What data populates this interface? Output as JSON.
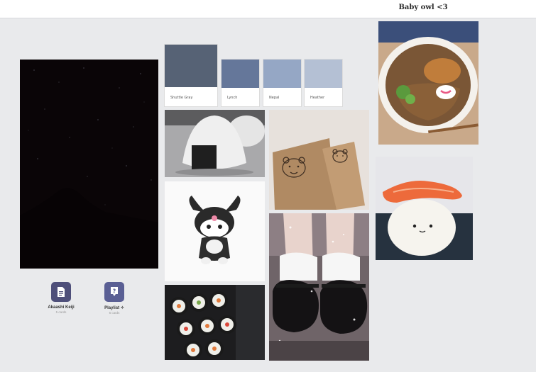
{
  "header": {
    "title": "Baby owl <3"
  },
  "palette": [
    {
      "name": "Shuttle Gray",
      "color": "#566275"
    },
    {
      "name": "Lynch",
      "color": "#65779a"
    },
    {
      "name": "Nepal",
      "color": "#95a7c5"
    },
    {
      "name": "Heather",
      "color": "#b4c0d4"
    }
  ],
  "boards": [
    {
      "name": "Akaashi Keiji",
      "count": "5 cards",
      "icon": "document-icon"
    },
    {
      "name": "Playlist ✧",
      "count": "6 cards",
      "icon": "question-icon"
    }
  ],
  "colors": {
    "accent": "#4e4f7a",
    "accent_light": "#5a5f94",
    "background": "#e9eaec"
  }
}
